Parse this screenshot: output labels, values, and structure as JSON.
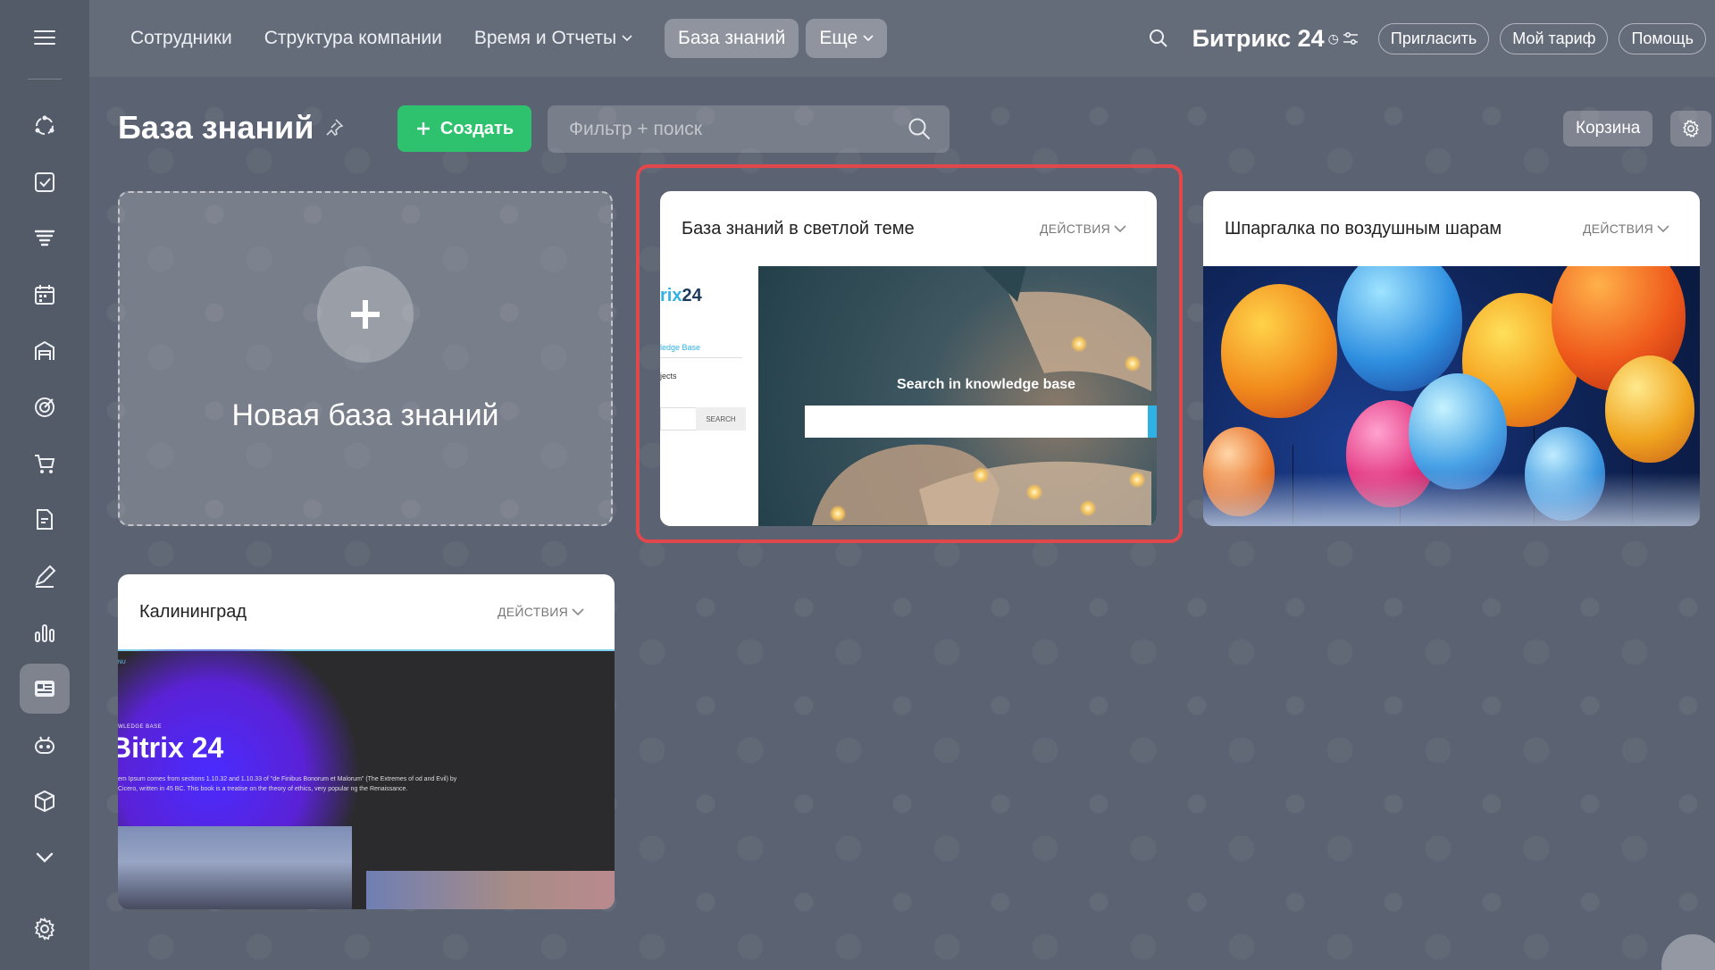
{
  "topbar": {
    "nav": [
      {
        "label": "Сотрудники",
        "dropdown": false
      },
      {
        "label": "Структура компании",
        "dropdown": false
      },
      {
        "label": "Время и Отчеты",
        "dropdown": true
      }
    ],
    "active_tab": "База знаний",
    "more_tab": "Еще",
    "brand": "Битрикс 24",
    "invite": "Пригласить",
    "tariff": "Мой тариф",
    "help": "Помощь"
  },
  "page": {
    "title": "База знаний",
    "create_label": "Создать",
    "search_placeholder": "Фильтр + поиск",
    "trash_label": "Корзина"
  },
  "new_card": {
    "label": "Новая база знаний"
  },
  "cards": [
    {
      "title": "База знаний в светлой теме",
      "actions": "ДЕЙСТВИЯ",
      "preview": {
        "logo_partial": "rix",
        "logo_number": "24",
        "link": "ledge Base",
        "item": "jects",
        "search_button": "SEARCH",
        "hero_text": "Search in knowledge base"
      }
    },
    {
      "title": "Шпаргалка по воздушным шарам",
      "actions": "ДЕЙСТВИЯ"
    },
    {
      "title": "Калининград",
      "actions": "ДЕЙСТВИЯ",
      "preview": {
        "menu": "NU",
        "small": "WLEDGE BASE",
        "heading": "Bitrix 24",
        "text": "em Ipsum comes from sections 1.10.32 and 1.10.33 of \"de Finibus Bonorum et Malorum\" (The Extremes of od and Evil) by Cicero, written in 45 BC. This book is a treatise on the theory of ethics, very popular ng the Renaissance."
      }
    }
  ],
  "colors": {
    "background": "#5b6271",
    "create_button": "#2fc26e",
    "highlight": "#e2474c"
  }
}
